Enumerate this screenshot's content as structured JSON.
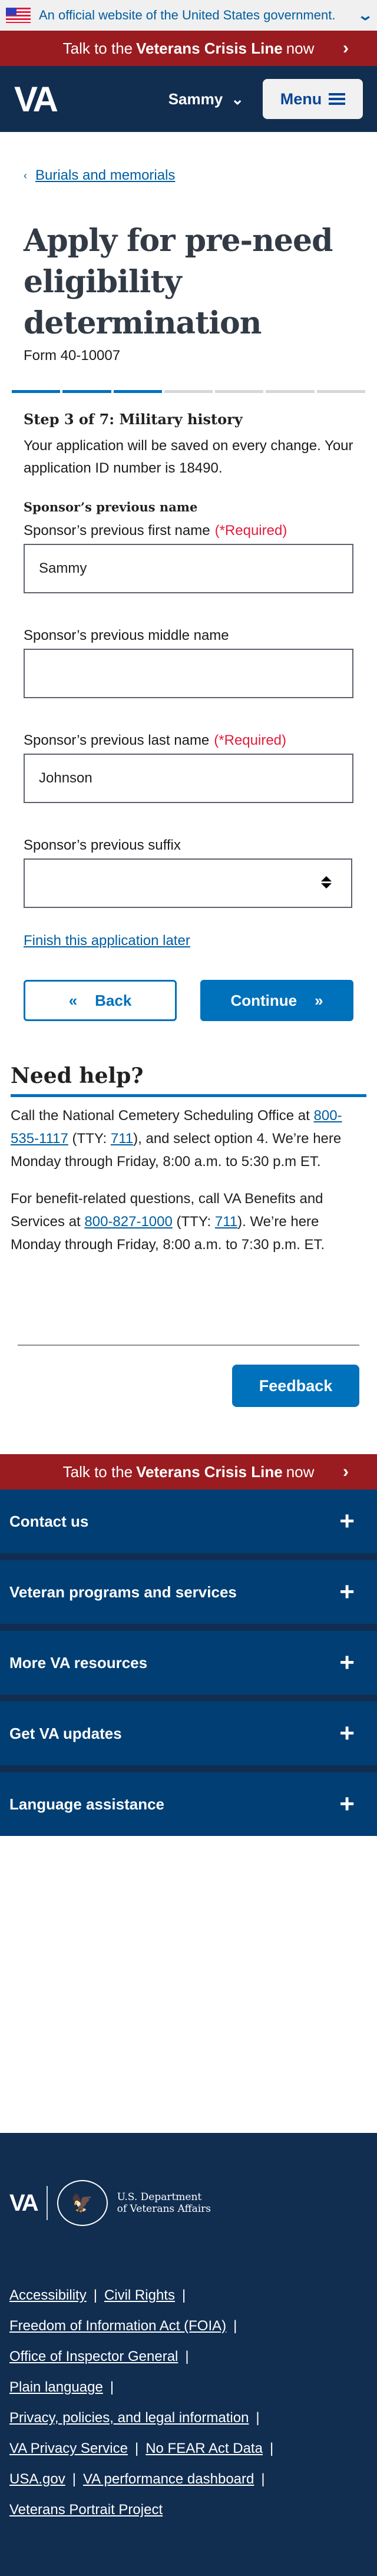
{
  "gov_banner": {
    "text": "An official website of the United States government."
  },
  "crisis": {
    "pre": "Talk to the ",
    "bold": "Veterans Crisis Line",
    "post": " now"
  },
  "header": {
    "logo": "VA",
    "user": "Sammy",
    "menu": "Menu"
  },
  "breadcrumb": "Burials and memorials",
  "title": "Apply for pre-need eligibility determination",
  "form_number": "Form 40-10007",
  "progress": {
    "current_step": 3,
    "total_steps": 7
  },
  "step_title": "Step 3 of 7: Military history",
  "intro": "Your application will be saved on every change. Your application ID number is 18490.",
  "section_title": "Sponsor’s previous name",
  "required_text": "(*Required)",
  "fields": {
    "first": {
      "label": "Sponsor’s previous first name",
      "value": "Sammy"
    },
    "middle": {
      "label": "Sponsor’s previous middle name",
      "value": ""
    },
    "last": {
      "label": "Sponsor’s previous last name",
      "value": "Johnson"
    },
    "suffix": {
      "label": "Sponsor’s previous suffix",
      "value": ""
    }
  },
  "finish_later": "Finish this application later",
  "buttons": {
    "back": "Back",
    "continue": "Continue",
    "feedback": "Feedback"
  },
  "help": {
    "title": "Need help?",
    "p1": {
      "a": "Call the National Cemetery Scheduling Office at ",
      "phone": "800-535-1117",
      "b": " (TTY: ",
      "tty": "711",
      "c": "), and select option 4. We’re here Monday through Friday, 8:00 a.m. to 5:30 p.m ET."
    },
    "p2": {
      "a": "For benefit-related questions, call VA Benefits and Services at ",
      "phone": "800-827-1000",
      "b": " (TTY: ",
      "tty": "711",
      "c": "). We’re here Monday through Friday, 8:00 a.m. to 7:30 p.m. ET."
    }
  },
  "footer": {
    "accordion": [
      "Contact us",
      "Veteran programs and services",
      "More VA resources",
      "Get VA updates",
      "Language assistance"
    ],
    "logo": "VA",
    "dept_line1": "U.S. Department",
    "dept_line2": "of Veterans Affairs",
    "links": [
      "Accessibility",
      "Civil Rights",
      "Freedom of Information Act (FOIA)",
      "Office of Inspector General",
      "Plain language",
      "Privacy, policies, and legal information",
      "VA Privacy Service",
      "No FEAR Act Data",
      "USA.gov",
      "VA performance dashboard",
      "Veterans Portrait Project"
    ]
  },
  "colors": {
    "primary": "#0071bb",
    "navy": "#112e51",
    "crisis": "#9a1c20",
    "required": "#e31c3d"
  }
}
